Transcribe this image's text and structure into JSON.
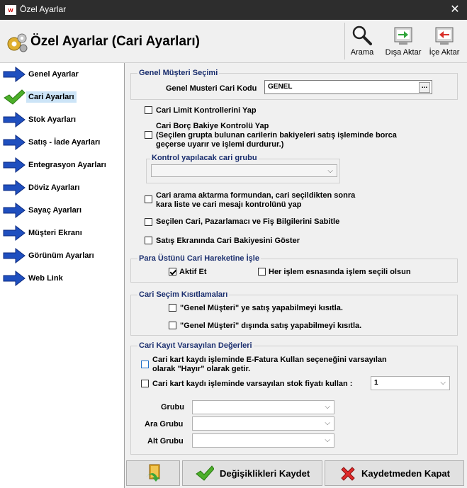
{
  "window": {
    "title": "Özel Ayarlar",
    "app_icon_text": "w"
  },
  "header": {
    "title": "Özel Ayarlar (Cari Ayarları)"
  },
  "toolbar": {
    "search_label": "Arama",
    "export_label": "Dışa Aktar",
    "import_label": "İçe Aktar"
  },
  "sidebar": {
    "items": [
      {
        "label": "Genel Ayarlar"
      },
      {
        "label": "Cari Ayarları"
      },
      {
        "label": "Stok Ayarları"
      },
      {
        "label": "Satış - İade Ayarları"
      },
      {
        "label": "Entegrasyon Ayarları"
      },
      {
        "label": "Döviz Ayarları"
      },
      {
        "label": "Sayaç Ayarları"
      },
      {
        "label": "Müşteri Ekranı"
      },
      {
        "label": "Görünüm Ayarları"
      },
      {
        "label": "Web Link"
      }
    ]
  },
  "general_customer": {
    "title": "Genel Müşteri Seçimi",
    "code_label": "Genel Musteri Cari Kodu",
    "code_value": "GENEL",
    "browse_label": "..."
  },
  "options": {
    "limit_control": "Cari Limit Kontrollerini Yap",
    "debt_control_line1": "Cari Borç Bakiye Kontrolü Yap",
    "debt_control_line2": "(Seçilen grupta bulunan carilerin bakiyeleri satış işleminde borca",
    "debt_control_line3": "geçerse uyarır ve işlemi durdurur.)",
    "control_group_title": "Kontrol yapılacak cari grubu",
    "search_transfer_line1": "Cari arama aktarma formundan, cari seçildikten sonra",
    "search_transfer_line2": "kara liste ve cari mesajı kontrolünü yap",
    "fix_selected": "Seçilen Cari, Pazarlamacı ve Fiş Bilgilerini Sabitle",
    "show_balance": "Satış Ekranında Cari Bakiyesini Göster"
  },
  "change_to_account": {
    "title": "Para Üstünü Cari Hareketine İşle",
    "active_label": "Aktif Et",
    "active_checked": true,
    "every_transaction_label": "Her işlem esnasında işlem seçili olsun"
  },
  "selection_restrictions": {
    "title": "Cari Seçim Kısıtlamaları",
    "restrict_sale_label": "\"Genel Müşteri\" ye satış yapabilmeyi kısıtla.",
    "restrict_outside_label": "\"Genel Müşteri\" dışında satış yapabilmeyi kısıtla."
  },
  "record_defaults": {
    "title": "Cari Kayıt Varsayılan Değerleri",
    "efatura_line1": "Cari kart kaydı işleminde E-Fatura Kullan seçeneğini varsayılan",
    "efatura_line2": "olarak \"Hayır\" olarak getir.",
    "default_price_label": "Cari kart kaydı işleminde varsayılan stok fiyatı kullan :",
    "default_price_value": "1",
    "group_label": "Grubu",
    "sub_group_label": "Ara Grubu",
    "bottom_group_label": "Alt Grubu"
  },
  "buttons": {
    "save_label": "Değişiklikleri Kaydet",
    "close_label": "Kaydetmeden Kapat"
  }
}
